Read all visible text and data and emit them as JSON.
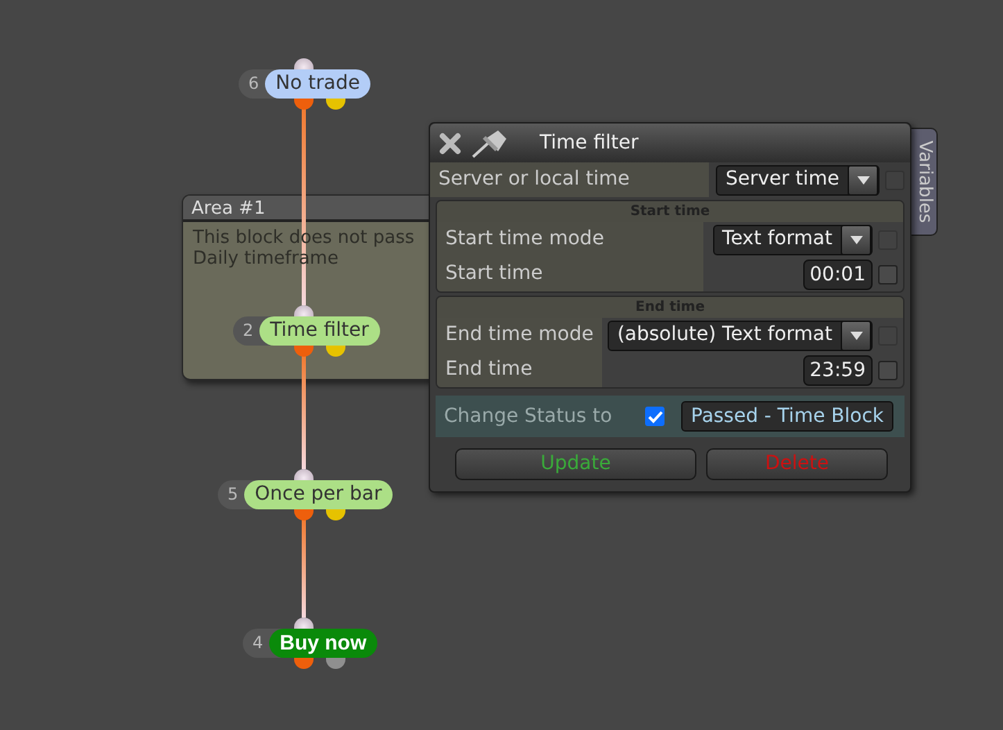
{
  "area": {
    "title": "Area #1",
    "lines": [
      "This block does not pass",
      "Daily timeframe"
    ]
  },
  "nodes": [
    {
      "number": "6",
      "label": "No trade",
      "kind": "condition",
      "color": "#b3cdf7",
      "outputs": [
        {
          "color": "#ee5f0c"
        },
        {
          "color": "#e6c200"
        }
      ]
    },
    {
      "number": "2",
      "label": "Time filter",
      "kind": "condition",
      "color": "#acdf86",
      "outputs": [
        {
          "color": "#ee5f0c"
        },
        {
          "color": "#e6c200"
        }
      ]
    },
    {
      "number": "5",
      "label": "Once per bar",
      "kind": "condition",
      "color": "#acdf86",
      "outputs": [
        {
          "color": "#ee5f0c"
        },
        {
          "color": "#e6c200"
        }
      ]
    },
    {
      "number": "4",
      "label": "Buy now",
      "kind": "action",
      "color": "#0a8a0a",
      "outputs": [
        {
          "color": "#ee5f0c"
        },
        {
          "color": "#8f8f8f"
        }
      ]
    }
  ],
  "dialog": {
    "title": "Time filter",
    "side_tab": "Variables",
    "fields": [
      {
        "kind": "select",
        "label": "Server or local time",
        "value": "Server time",
        "checked": false,
        "disabled": true
      }
    ],
    "sections": [
      {
        "title": "Start time",
        "fields": [
          {
            "kind": "select",
            "label": "Start time mode",
            "value": "Text format",
            "checked": false,
            "disabled": true
          },
          {
            "kind": "text",
            "label": "Start time",
            "value": "00:01",
            "checked": false
          }
        ]
      },
      {
        "title": "End time",
        "fields": [
          {
            "kind": "select",
            "label": "End time mode",
            "value": "(absolute) Text format",
            "checked": false,
            "disabled": true
          },
          {
            "kind": "text",
            "label": "End time",
            "value": "23:59",
            "checked": false
          }
        ]
      }
    ],
    "status": {
      "label": "Change Status to",
      "checked": true,
      "value": "Passed - Time Block"
    },
    "buttons": [
      {
        "kind": "update",
        "label": "Update"
      },
      {
        "kind": "delete",
        "label": "Delete"
      }
    ]
  }
}
